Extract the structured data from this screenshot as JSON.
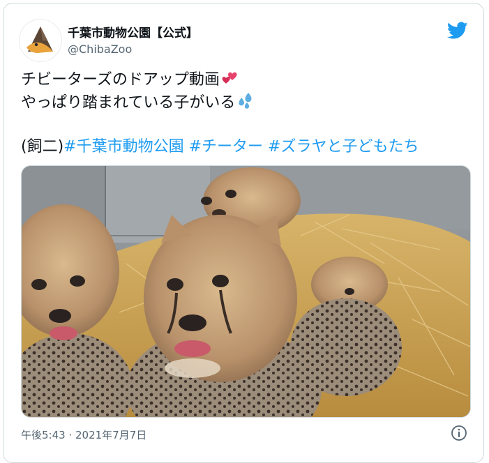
{
  "account": {
    "name": "千葉市動物公園【公式】",
    "handle": "@ChibaZoo"
  },
  "tweet": {
    "line1": "チビーターズのドアップ動画",
    "line2": "やっぱり踏まれている子がいる",
    "prefix": "(飼二)",
    "hashtags": [
      "#千葉市動物公園",
      "#チーター",
      "#ズラヤと子どもたち"
    ],
    "emoji1": "two-hearts",
    "emoji2": "sweat-droplets"
  },
  "media": {
    "subject": "cheetah cubs on straw"
  },
  "meta": {
    "timestamp": "午後5:43 · 2021年7月7日"
  },
  "colors": {
    "link": "#1d9bf0",
    "secondary_text": "#536471",
    "border": "#cfd9de"
  }
}
